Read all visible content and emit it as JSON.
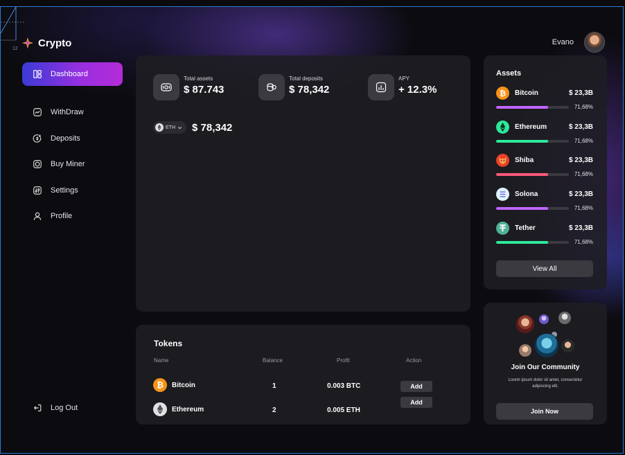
{
  "app": {
    "name": "Crypto"
  },
  "guide_number": "12",
  "user": {
    "name": "Evano"
  },
  "sidebar": {
    "items": [
      {
        "label": "Dashboard",
        "icon": "dashboard-icon",
        "active": true
      },
      {
        "label": "WithDraw",
        "icon": "chart-icon"
      },
      {
        "label": "Deposits",
        "icon": "deposit-icon"
      },
      {
        "label": "Buy Miner",
        "icon": "miner-icon"
      },
      {
        "label": "Settings",
        "icon": "settings-icon"
      },
      {
        "label": "Profile",
        "icon": "profile-icon"
      }
    ],
    "logout": "Log Out"
  },
  "stats": [
    {
      "label": "Total assets",
      "value": "$ 87.743",
      "icon": "wallet-icon"
    },
    {
      "label": "Total deposits",
      "value": "$ 78,342",
      "icon": "coins-icon"
    },
    {
      "label": "APY",
      "value": "+ 12.3%",
      "icon": "bar-chart-icon"
    }
  ],
  "balance": {
    "currency": "ETH",
    "value": "$ 78,342"
  },
  "tokens": {
    "title": "Tokens",
    "headers": [
      "Name",
      "Balance",
      "Profit",
      "Action"
    ],
    "rows": [
      {
        "name": "Bitcoin",
        "balance": "1",
        "profit": "0.003 BTC",
        "action": "Add"
      },
      {
        "name": "Ethereum",
        "balance": "2",
        "profit": "0.005 ETH",
        "action": "Add"
      }
    ]
  },
  "assets": {
    "title": "Assets",
    "items": [
      {
        "name": "Bitcoin",
        "price": "$ 23,3B",
        "percent": "71,68%",
        "fill": 0.7168,
        "color": "#c064ff",
        "icon_color": "#f7931a"
      },
      {
        "name": "Ethereum",
        "price": "$ 23,3B",
        "percent": "71,68%",
        "fill": 0.7168,
        "color": "#2ee89a",
        "icon_color": "#2ee89a"
      },
      {
        "name": "Shiba",
        "price": "$ 23,3B",
        "percent": "71,68%",
        "fill": 0.7168,
        "color": "#ff5a7a",
        "icon_color": "#e8402a"
      },
      {
        "name": "Solona",
        "price": "$ 23,3B",
        "percent": "71,68%",
        "fill": 0.7168,
        "color": "#c064ff",
        "icon_color": "#dff3ff"
      },
      {
        "name": "Tether",
        "price": "$ 23,3B",
        "percent": "71,68%",
        "fill": 0.7168,
        "color": "#2ee89a",
        "icon_color": "#50af95"
      }
    ],
    "view_all": "View All"
  },
  "community": {
    "title": "Join Our Community",
    "text": "Lorem ipsum dolor sit amet, consectetur adipiscing elit.",
    "button": "Join Now"
  }
}
